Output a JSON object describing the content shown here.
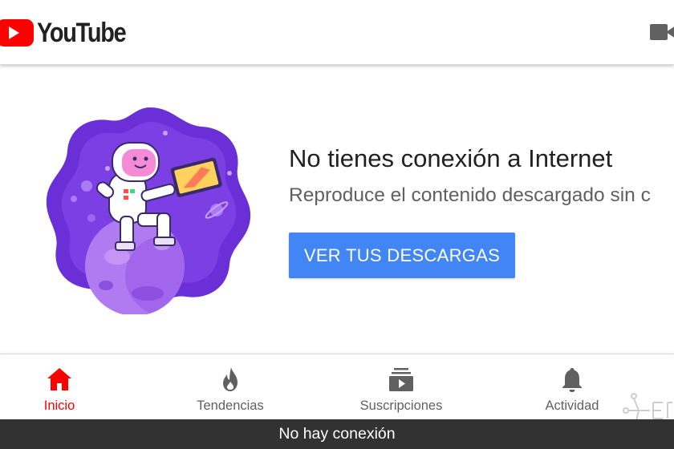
{
  "header": {
    "app_name": "YouTube",
    "logo_icon": "youtube-play-icon",
    "camera_icon": "video-camera-icon"
  },
  "offline": {
    "title": "No tienes conexión a Internet",
    "subtitle": "Reproduce el contenido descargado sin c",
    "button_label": "VER TUS DESCARGAS",
    "illustration": "astronaut-on-planet-illustration"
  },
  "nav": {
    "items": [
      {
        "label": "Inicio",
        "icon": "home-icon",
        "active": true
      },
      {
        "label": "Tendencias",
        "icon": "flame-icon",
        "active": false
      },
      {
        "label": "Suscripciones",
        "icon": "subscriptions-icon",
        "active": false
      },
      {
        "label": "Actividad",
        "icon": "bell-icon",
        "active": false
      }
    ]
  },
  "snackbar": {
    "message": "No hay conexión"
  },
  "colors": {
    "brand_red": "#ff0000",
    "button_blue": "#4285f4",
    "illustration_purple": "#7b3fe4",
    "snackbar_bg": "#323232"
  }
}
